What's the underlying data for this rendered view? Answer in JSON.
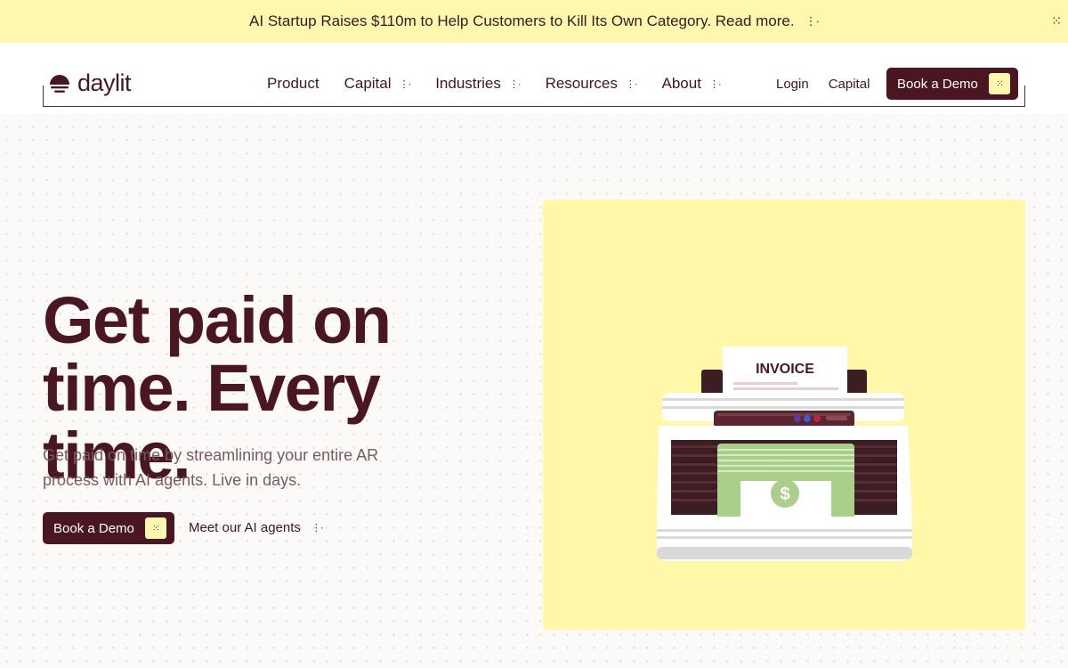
{
  "announcement": {
    "text": "AI Startup Raises $110m to Help Customers to Kill Its Own Category. Read more.",
    "icon": "dots-arrow-icon"
  },
  "brand": {
    "name": "daylit"
  },
  "nav": {
    "items": [
      {
        "label": "Product",
        "has_menu": false
      },
      {
        "label": "Capital",
        "has_menu": true
      },
      {
        "label": "Industries",
        "has_menu": true
      },
      {
        "label": "Resources",
        "has_menu": true
      },
      {
        "label": "About",
        "has_menu": true
      }
    ],
    "login": "Login",
    "capital": "Capital",
    "cta": "Book a Demo"
  },
  "hero": {
    "headline_line1": "Get paid on",
    "headline_line2": "time. Every time.",
    "subtext": "Get paid on time by streamlining your entire AR process with AI agents. Live in days.",
    "primary_cta": "Book a Demo",
    "secondary_cta": "Meet our AI agents"
  },
  "illustration": {
    "invoice_label": "INVOICE",
    "currency_symbol": "$"
  },
  "colors": {
    "brand": "#4a1622",
    "accent_yellow": "#fdf8ad",
    "panel_yellow": "#fff8a8",
    "cash_green": "#a9cf8a"
  }
}
